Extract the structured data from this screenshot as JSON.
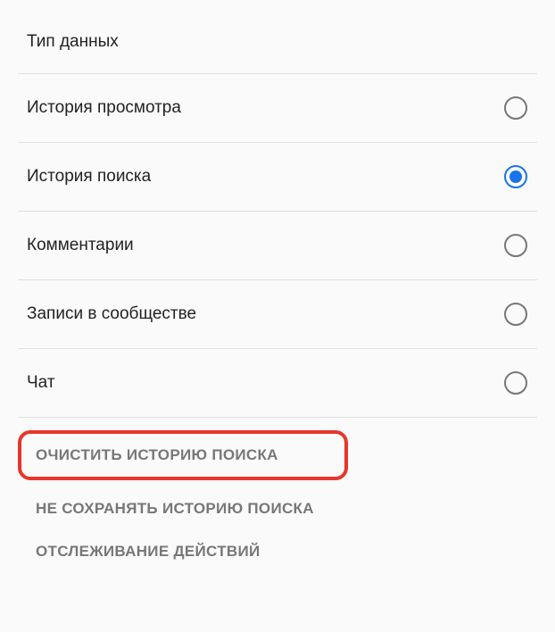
{
  "section_title": "Тип данных",
  "options": [
    {
      "label": "История просмотра",
      "selected": false
    },
    {
      "label": "История поиска",
      "selected": true
    },
    {
      "label": "Комментарии",
      "selected": false
    },
    {
      "label": "Записи в сообществе",
      "selected": false
    },
    {
      "label": "Чат",
      "selected": false
    }
  ],
  "actions": {
    "clear_search_history": "ОЧИСТИТЬ ИСТОРИЮ ПОИСКА",
    "pause_search_history": "НЕ СОХРАНЯТЬ ИСТОРИЮ ПОИСКА",
    "activity_tracking": "ОТСЛЕЖИВАНИЕ ДЕЙСТВИЙ"
  },
  "colors": {
    "accent": "#1a73e8",
    "highlight": "#e8352b"
  }
}
